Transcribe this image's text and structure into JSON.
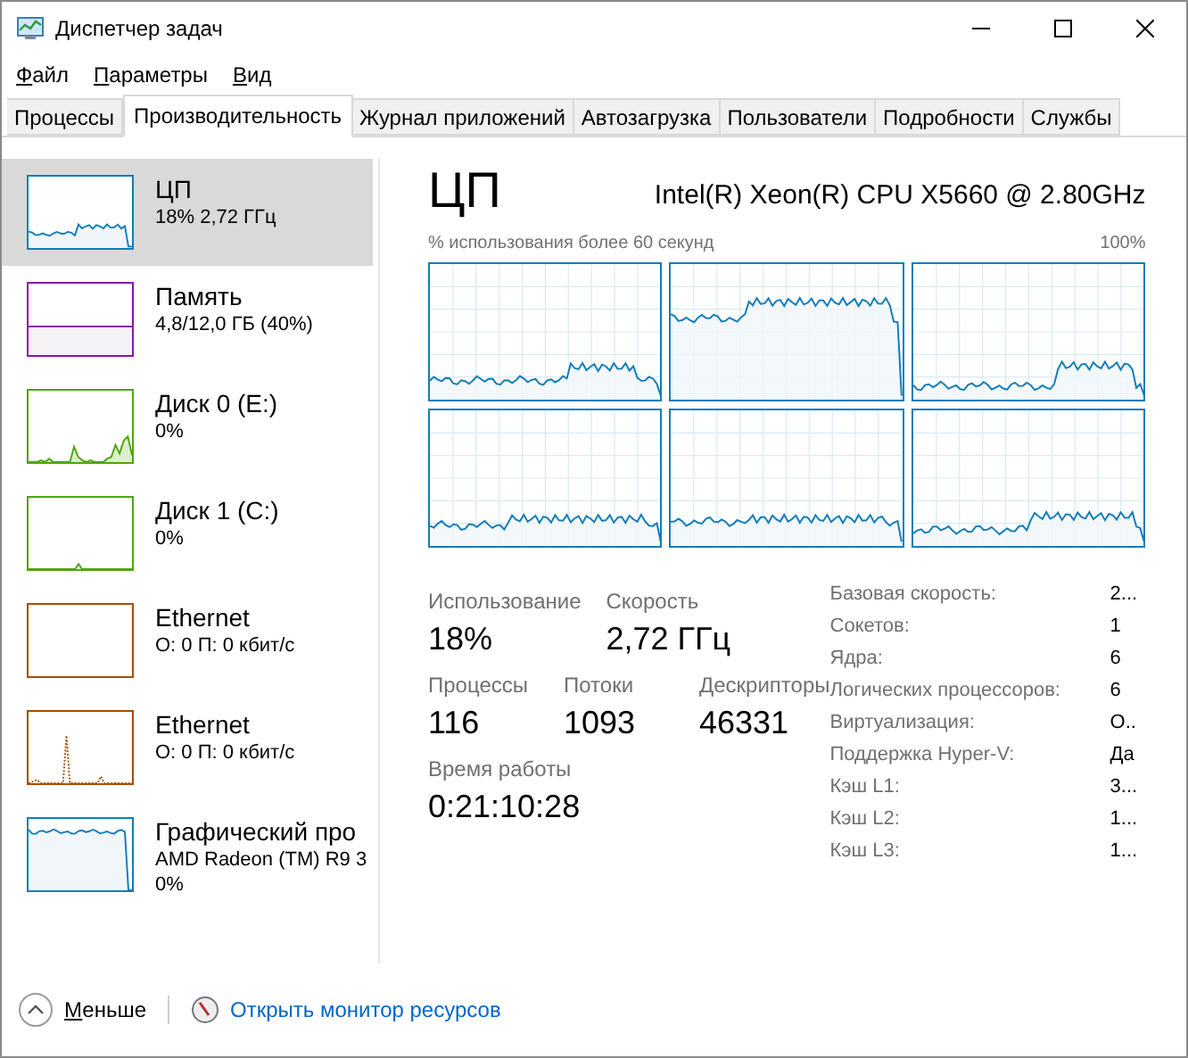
{
  "window": {
    "title": "Диспетчер задач"
  },
  "menu": [
    "Файл",
    "Параметры",
    "Вид"
  ],
  "tabs": [
    {
      "label": "Процессы",
      "selected": false
    },
    {
      "label": "Производительность",
      "selected": true
    },
    {
      "label": "Журнал приложений",
      "selected": false
    },
    {
      "label": "Автозагрузка",
      "selected": false
    },
    {
      "label": "Пользователи",
      "selected": false
    },
    {
      "label": "Подробности",
      "selected": false
    },
    {
      "label": "Службы",
      "selected": false
    }
  ],
  "sidebar": {
    "items": [
      {
        "kind": "cpu",
        "color": "#117dbb",
        "name": "ЦП",
        "details": [
          "18% 2,72 ГГц"
        ],
        "selected": true
      },
      {
        "kind": "memory",
        "color": "#8b12ae",
        "name": "Память",
        "details": [
          "4,8/12,0 ГБ (40%)"
        ],
        "selected": false
      },
      {
        "kind": "disk",
        "color": "#4da60c",
        "name": "Диск 0 (E:)",
        "details": [
          "0%"
        ],
        "selected": false
      },
      {
        "kind": "disk-idle",
        "color": "#4da60c",
        "name": "Диск 1 (C:)",
        "details": [
          "0%"
        ],
        "selected": false
      },
      {
        "kind": "network-idle",
        "color": "#a74f01",
        "name": "Ethernet",
        "details": [
          "О: 0 П: 0 кбит/с"
        ],
        "selected": false
      },
      {
        "kind": "network",
        "color": "#a74f01",
        "name": "Ethernet",
        "details": [
          "О: 0 П: 0 кбит/с"
        ],
        "selected": false
      },
      {
        "kind": "gpu",
        "color": "#117dbb",
        "name": "Графический про",
        "details": [
          "AMD Radeon (TM) R9 3",
          "0%"
        ],
        "selected": false
      }
    ]
  },
  "main": {
    "title": "ЦП",
    "model": "Intel(R) Xeon(R) CPU X5660 @ 2.80GHz",
    "graph_caption": "% использования более 60 секунд",
    "graph_max": "100%",
    "stats": [
      [
        {
          "label": "Использование",
          "value": "18%"
        },
        {
          "label": "Скорость",
          "value": "2,72 ГГц"
        }
      ],
      [
        {
          "label": "Процессы",
          "value": "116"
        },
        {
          "label": "Потоки",
          "value": "1093"
        },
        {
          "label": "Дескрипторы",
          "value": "46331"
        }
      ],
      [
        {
          "label": "Время работы",
          "value": "0:21:10:28"
        }
      ]
    ],
    "specs": [
      {
        "label": "Базовая скорость:",
        "value": "2..."
      },
      {
        "label": "Сокетов:",
        "value": "1"
      },
      {
        "label": "Ядра:",
        "value": "6"
      },
      {
        "label": "Логических процессоров:",
        "value": "6"
      },
      {
        "label": "Виртуализация:",
        "value": "О.."
      },
      {
        "label": "Поддержка Hyper-V:",
        "value": "Да"
      },
      {
        "label": "Кэш L1:",
        "value": "3..."
      },
      {
        "label": "Кэш L2:",
        "value": "1..."
      },
      {
        "label": "Кэш L3:",
        "value": "1..."
      }
    ]
  },
  "footer": {
    "less": "Меньше",
    "link": "Открыть монитор ресурсов"
  }
}
